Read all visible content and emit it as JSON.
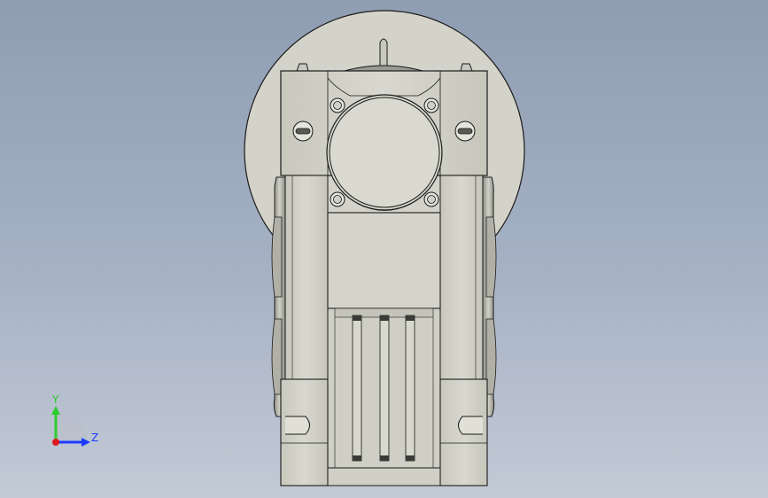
{
  "viewport": {
    "background_top": "#8f9db3",
    "background_bottom": "#c3cad6"
  },
  "model": {
    "name": "worm-gear-reducer",
    "body_color": "#d2d2c8",
    "edge_color": "#1a1a1a",
    "shadow_color": "#a8a8a0"
  },
  "triad": {
    "y_label": "Y",
    "z_label": "Z",
    "y_color": "#2ecc2e",
    "z_color": "#1a3cff",
    "x_color": "#e01a1a"
  }
}
